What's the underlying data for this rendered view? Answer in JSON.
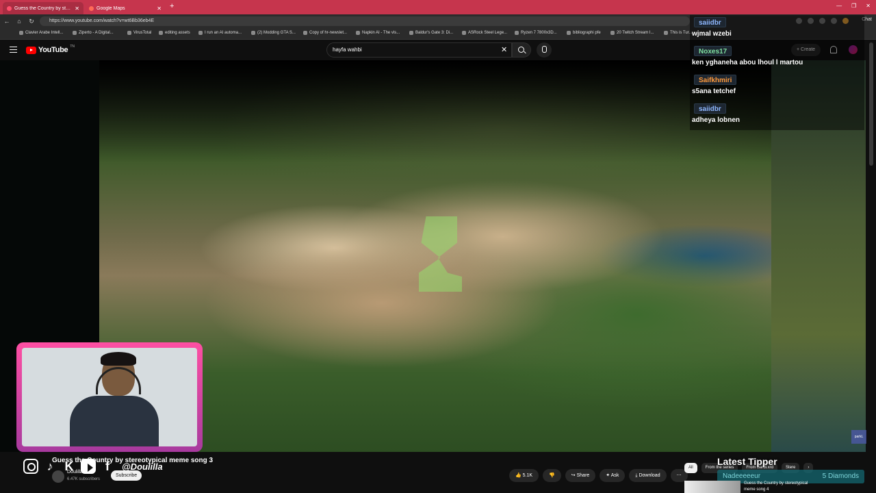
{
  "browser": {
    "tabs": [
      {
        "label": "Guess the Country by stereotypic...",
        "active": true
      },
      {
        "label": "Google Maps",
        "active": false
      }
    ],
    "url": "https://www.youtube.com/watch?v=wt6Bb36eb4E",
    "chat_label": "Chat",
    "bookmarks": [
      "Clavier Arabe Intell...",
      "Ziperto - A Digital...",
      "VirusTotal",
      "editing assets",
      "I run an AI automa...",
      "(2) Modding GTA S...",
      "Copy of hr-newslet...",
      "Napkin AI - The vis...",
      "Baldur's Gate 3: Di...",
      "ASRock Steel Lege...",
      "Ryzen 7 7800x3D...",
      "bibliographi pfe",
      "20 Twitch Stream I...",
      "This is Tur..."
    ]
  },
  "youtube": {
    "logo_text": "YouTube",
    "logo_sup": "TN",
    "search_value": "hayfa wahbi",
    "create_label": "Create"
  },
  "chat": [
    {
      "user": "saiidbr",
      "message": "wjmal wzebi",
      "color": "#8fb8ff"
    },
    {
      "user": "Noxes17",
      "message": "ken yghaneha abou lhoul l martou",
      "color": "#7fe0a0"
    },
    {
      "user": "Saifkhmiri",
      "message": "s5ana tetchef",
      "color": "#ff9a3c"
    },
    {
      "user": "saiidbr",
      "message": "adheya lobnen",
      "color": "#8fb8ff"
    }
  ],
  "video": {
    "title": "Guess the Country by stereotypical meme song 3",
    "channel": "Doulilla",
    "subscribers": "6.47K subscribers",
    "subscribe_label": "Subscribe",
    "handle": "@Doulilla",
    "likes": "5.1K",
    "share_label": "Share",
    "ask_label": "Ask",
    "download_label": "Download"
  },
  "chips": [
    "All",
    "From the series",
    "From Bardi.xrd",
    "Stere"
  ],
  "latest_tipper": {
    "title": "Latest Tipper",
    "name": "Nadeeeeeur",
    "amount": "5 Diamonds"
  },
  "recommendation": {
    "title": "Guess the Country by stereotypical meme song 4"
  },
  "watermark": "parkL"
}
